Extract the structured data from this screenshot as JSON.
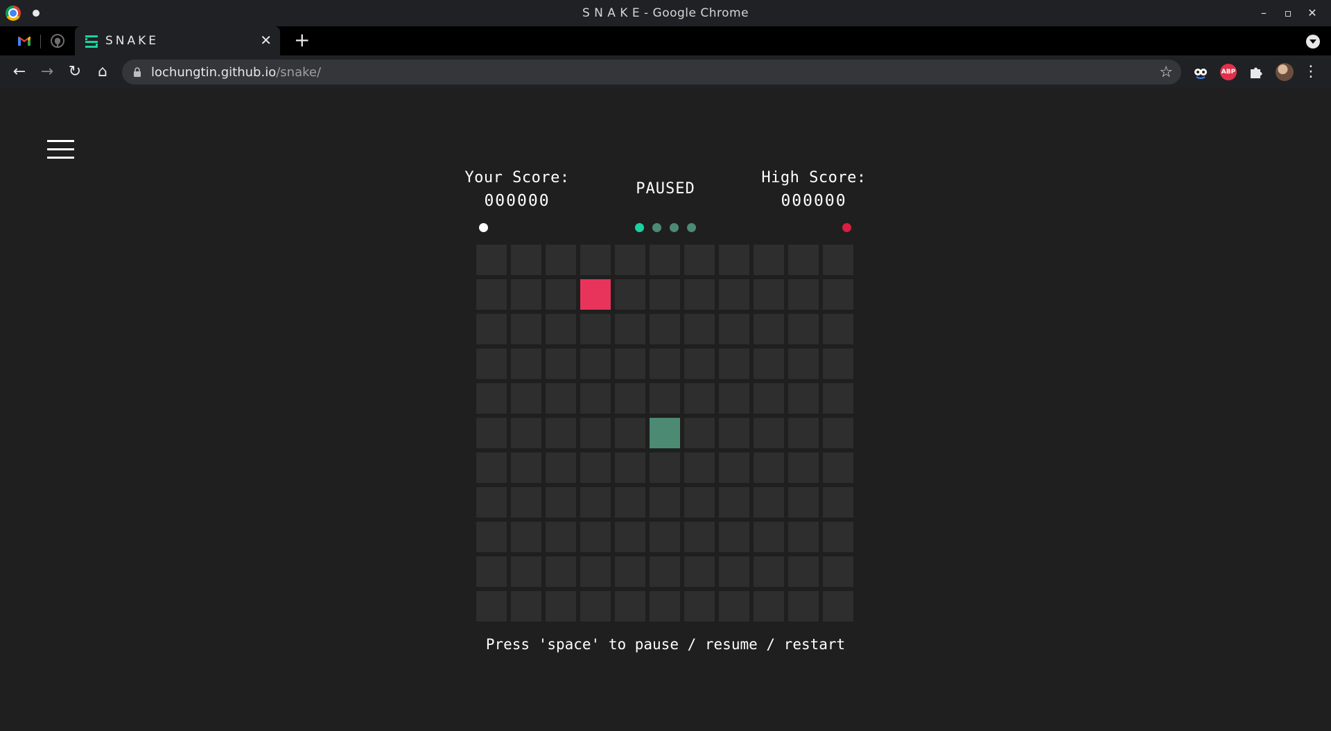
{
  "window": {
    "title": "S N A K E - Google Chrome"
  },
  "tabs": [
    {
      "icon": "gmail-icon"
    },
    {
      "icon": "github-icon"
    },
    {
      "label": "SNAKE",
      "icon": "snake-favicon-icon",
      "active": true
    }
  ],
  "address_bar": {
    "host": "lochungtin.github.io",
    "path": "/snake/"
  },
  "game": {
    "your_score_label": "Your Score:",
    "your_score": "000000",
    "status": "PAUSED",
    "high_score_label": "High Score:",
    "high_score": "000000",
    "hint": "Press 'space' to pause / resume / restart",
    "grid": {
      "rows": 11,
      "cols": 11
    },
    "food_cell": {
      "row": 1,
      "col": 3
    },
    "snake_cells": [
      {
        "row": 5,
        "col": 5
      }
    ],
    "speed_indicator": {
      "levels": 4,
      "active": 1
    }
  },
  "colors": {
    "background": "#1f1f1f",
    "cell": "#2e2e2e",
    "food": "#e8345a",
    "snake": "#4c8a73",
    "dot_active": "#19d3a0",
    "dot_inactive": "#4c8a73",
    "dot_white": "#ffffff",
    "dot_red": "#d81f3f"
  }
}
